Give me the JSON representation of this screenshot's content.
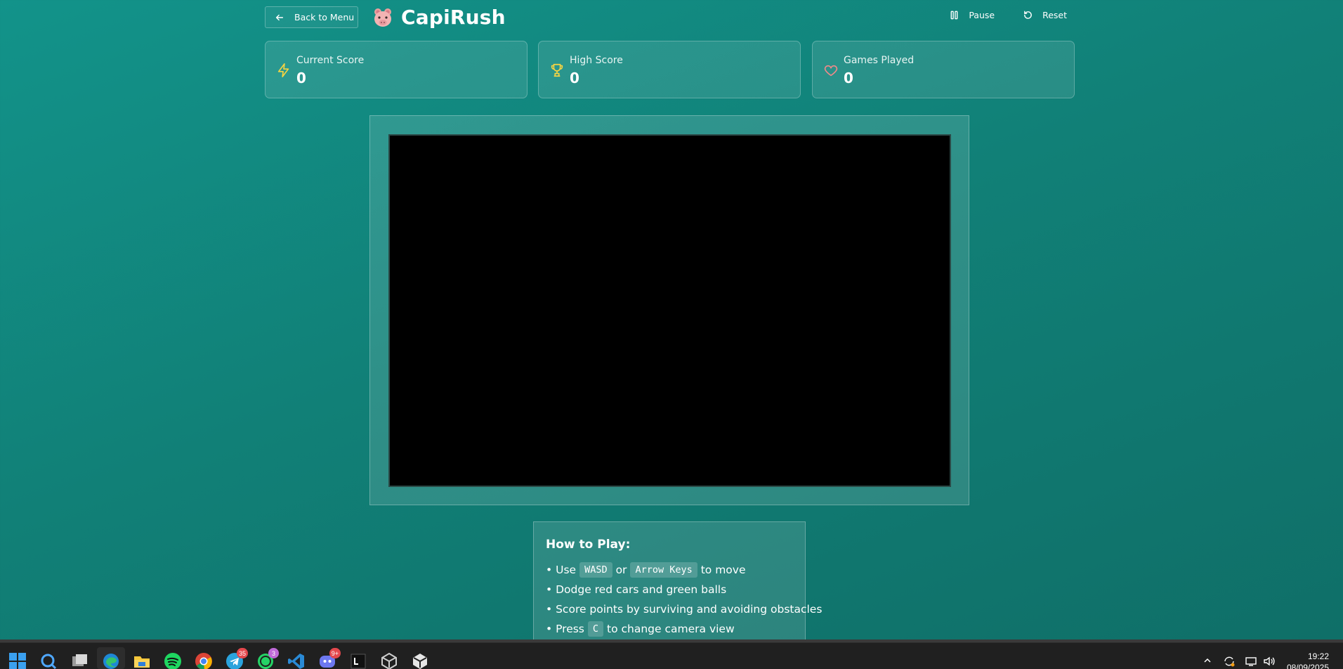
{
  "header": {
    "back_label": "Back to Menu",
    "title": "CapiRush",
    "pause_label": "Pause",
    "reset_label": "Reset"
  },
  "stats": {
    "current": {
      "label": "Current Score",
      "value": "0",
      "icon": "lightning-icon",
      "color": "#f5d442"
    },
    "high": {
      "label": "High Score",
      "value": "0",
      "icon": "trophy-icon",
      "color": "#f5d442"
    },
    "games": {
      "label": "Games Played",
      "value": "0",
      "icon": "heart-icon",
      "color": "#f08a8a"
    }
  },
  "howto": {
    "title": "How to Play:",
    "bullet": "•",
    "line1": {
      "a": "Use",
      "k1": "WASD",
      "b": "or",
      "k2": "Arrow Keys",
      "c": "to move"
    },
    "line2": "Dodge red cars and green balls",
    "line3": "Score points by surviving and avoiding obstacles",
    "line4": {
      "a": "Press",
      "k1": "C",
      "b": "to change camera view"
    }
  },
  "taskbar": {
    "icons": [
      "windows-start-icon",
      "search-icon",
      "task-view-icon",
      "edge-icon",
      "file-explorer-icon",
      "spotify-icon",
      "chrome-icon",
      "telegram-icon",
      "whatsapp-icon",
      "vscode-icon",
      "discord-icon",
      "terminal-icon",
      "unity-icon",
      "unity-hub-icon"
    ],
    "badges": {
      "telegram": "35",
      "whatsapp": "3",
      "discord": "9+"
    },
    "time": "19:22",
    "date": "08/09/2025"
  },
  "colors": {
    "background": "#118077",
    "canvas": "#000000",
    "accent_yellow": "#f5d442"
  }
}
